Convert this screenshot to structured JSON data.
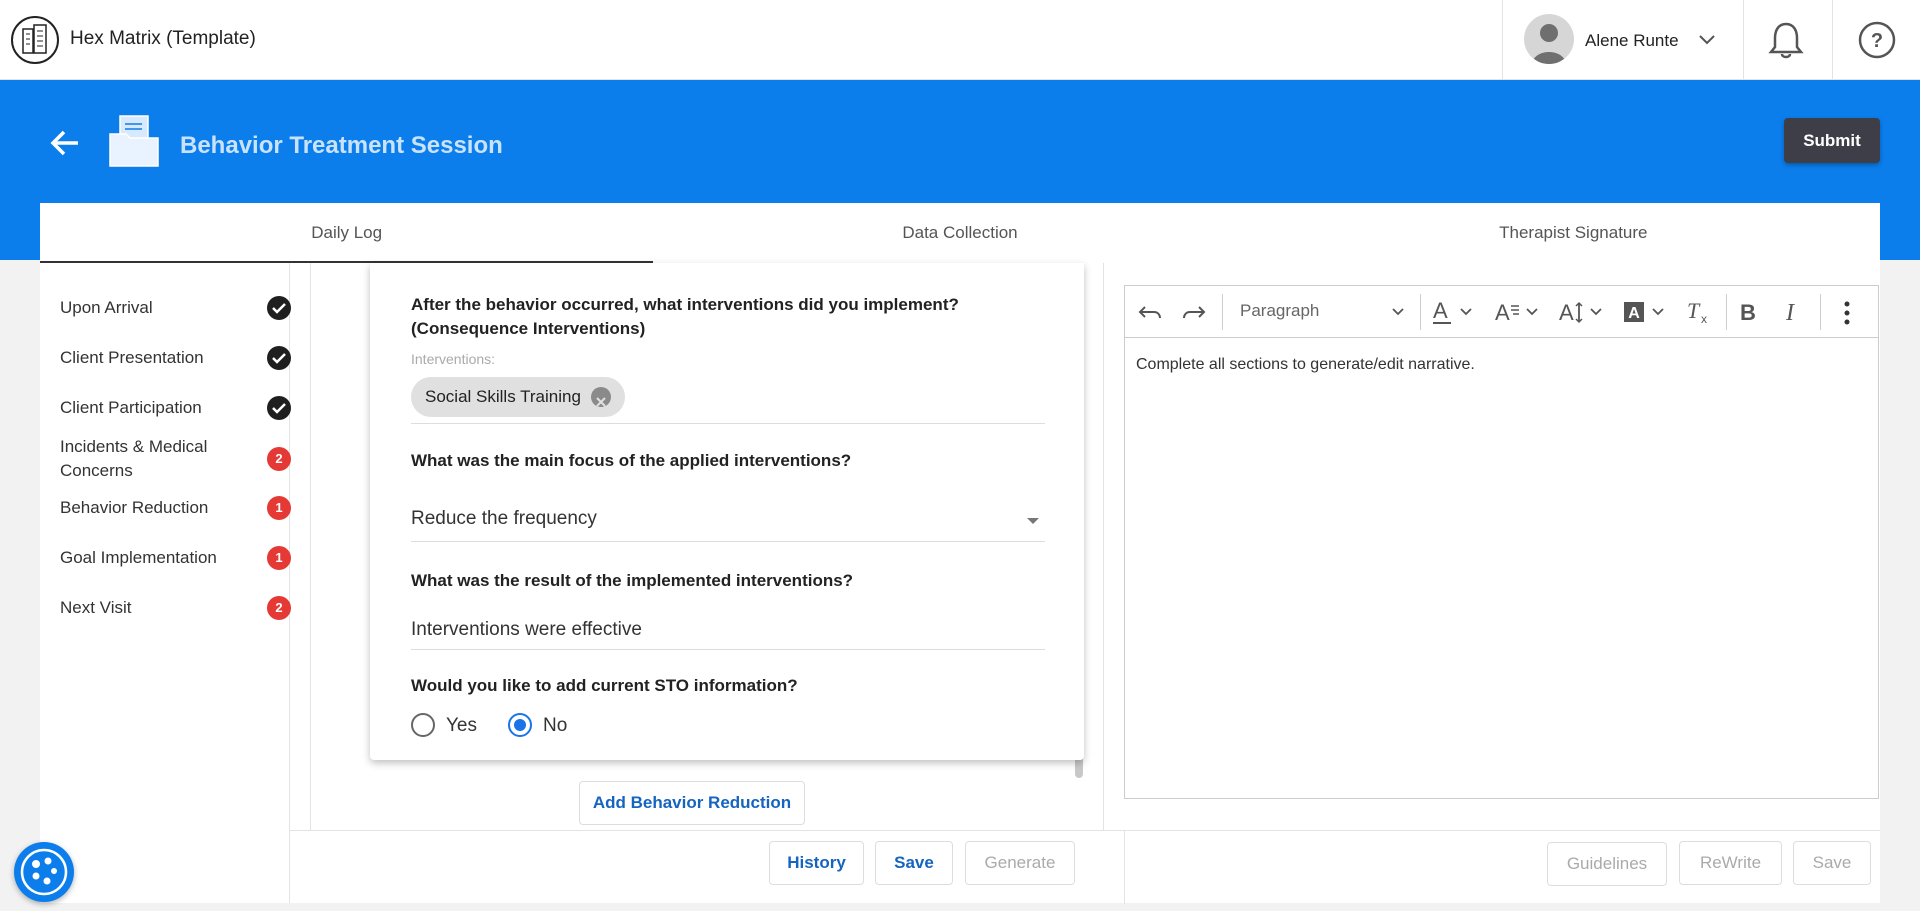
{
  "app": {
    "title": "Hex Matrix (Template)"
  },
  "user": {
    "name": "Alene Runte"
  },
  "header": {
    "title": "Behavior Treatment Session",
    "submit_label": "Submit"
  },
  "tabs": [
    {
      "label": "Daily Log",
      "active": true
    },
    {
      "label": "Data Collection",
      "active": false
    },
    {
      "label": "Therapist Signature",
      "active": false
    }
  ],
  "sidebar": {
    "items": [
      {
        "label": "Upon Arrival",
        "status": "complete"
      },
      {
        "label": "Client Presentation",
        "status": "complete"
      },
      {
        "label": "Client Participation",
        "status": "complete"
      },
      {
        "label": "Incidents & Medical Concerns",
        "badge": "2"
      },
      {
        "label": "Behavior Reduction",
        "badge": "1"
      },
      {
        "label": "Goal Implementation",
        "badge": "1"
      },
      {
        "label": "Next Visit",
        "badge": "2"
      }
    ]
  },
  "form": {
    "q1": "After the behavior occurred, what interventions did you implement? (Consequence Interventions)",
    "interventions_label": "Interventions:",
    "chip": "Social Skills Training",
    "q2": "What was the main focus of the applied interventions?",
    "focus_value": "Reduce the frequency",
    "q3": "What was the result of the implemented interventions?",
    "result_value": "Interventions were effective",
    "q4": "Would you like to add current STO information?",
    "radio_yes": "Yes",
    "radio_no": "No",
    "selected": "No",
    "add_button": "Add Behavior Reduction"
  },
  "bottom_left": {
    "history": "History",
    "save": "Save",
    "generate": "Generate"
  },
  "editor": {
    "paragraph_label": "Paragraph",
    "placeholder": "Complete all sections to generate/edit narrative."
  },
  "bottom_right": {
    "guidelines": "Guidelines",
    "rewrite": "ReWrite",
    "save": "Save"
  },
  "colors": {
    "primary": "#0b7eec",
    "submit_bg": "#3d3e47",
    "badge": "#e53935",
    "link": "#1565c0"
  }
}
